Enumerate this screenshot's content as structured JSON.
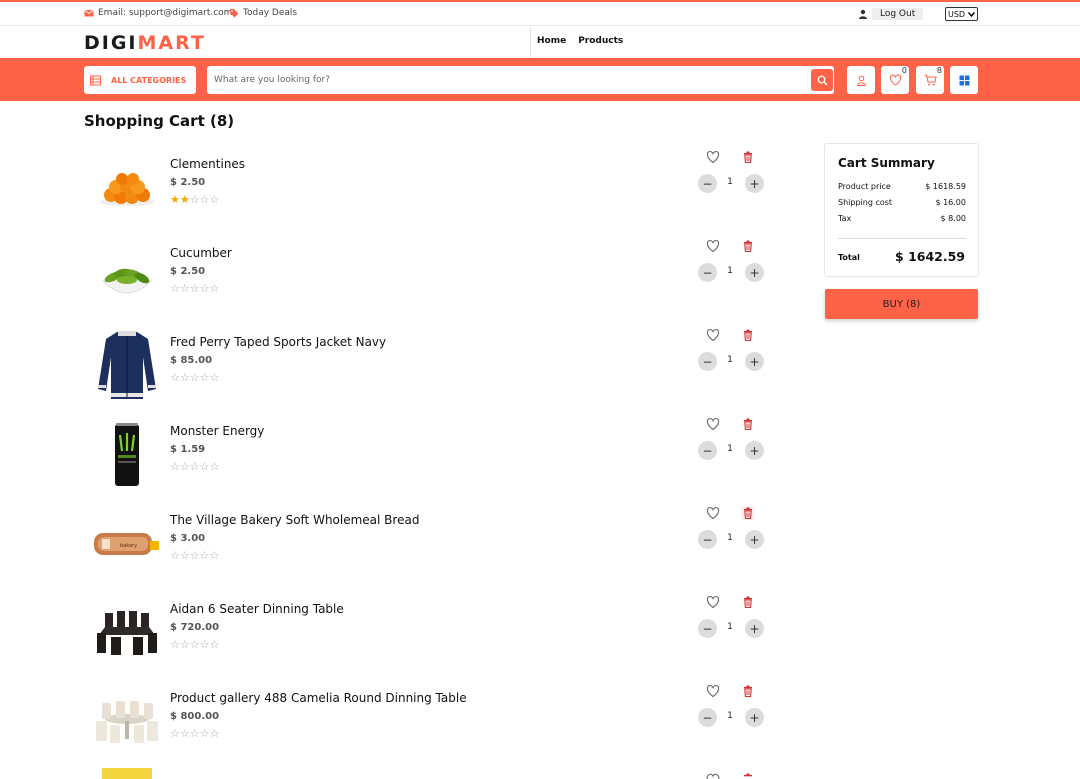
{
  "topbar": {
    "email": "Email: support@digimart.com",
    "deals": "Today Deals",
    "logout": "Log Out",
    "currency": "USD"
  },
  "brand": {
    "part1": "DIGI",
    "part2": "MART"
  },
  "nav": {
    "home": "Home",
    "products": "Products"
  },
  "search": {
    "categories_label": "ALL CATEGORIES",
    "placeholder": "What are you looking for?"
  },
  "header_icons": {
    "wishlist_count": "0",
    "cart_count": "8"
  },
  "page_title": "Shopping Cart (8)",
  "cart_items": [
    {
      "name": "Clementines",
      "price": "$ 2.50",
      "rating": 2,
      "qty": "1"
    },
    {
      "name": "Cucumber",
      "price": "$ 2.50",
      "rating": 0,
      "qty": "1"
    },
    {
      "name": "Fred Perry Taped Sports Jacket Navy",
      "price": "$ 85.00",
      "rating": 0,
      "qty": "1"
    },
    {
      "name": "Monster Energy",
      "price": "$ 1.59",
      "rating": 0,
      "qty": "1"
    },
    {
      "name": "The Village Bakery Soft Wholemeal Bread",
      "price": "$ 3.00",
      "rating": 0,
      "qty": "1"
    },
    {
      "name": "Aidan 6 Seater Dinning Table",
      "price": "$ 720.00",
      "rating": 0,
      "qty": "1"
    },
    {
      "name": "Product gallery 488 Camelia Round Dinning Table",
      "price": "$ 800.00",
      "rating": 0,
      "qty": "1"
    }
  ],
  "summary": {
    "title": "Cart Summary",
    "product_price_label": "Product price",
    "product_price": "$ 1618.59",
    "shipping_label": "Shipping cost",
    "shipping": "$ 16.00",
    "tax_label": "Tax",
    "tax": "$ 8.00",
    "total_label": "Total",
    "total": "$ 1642.59"
  },
  "buy_label": "BUY (8)",
  "colors": {
    "accent": "#ff6347",
    "star": "#f0a500",
    "trash": "#d32f2f"
  }
}
